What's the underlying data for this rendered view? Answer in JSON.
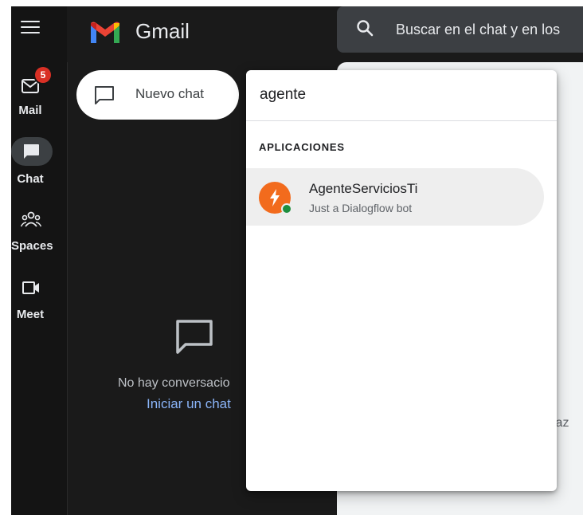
{
  "app": {
    "name": "Gmail"
  },
  "rail": {
    "mail": {
      "label": "Mail",
      "badge": "5"
    },
    "chat": {
      "label": "Chat"
    },
    "spaces": {
      "label": "Spaces"
    },
    "meet": {
      "label": "Meet"
    }
  },
  "search": {
    "placeholder": "Buscar en el chat y en los"
  },
  "new_chat": {
    "label": "Nuevo chat"
  },
  "empty_state": {
    "text": "No hay conversacio",
    "link": "Iniciar un chat"
  },
  "main_hint": "Haz",
  "dropdown": {
    "query": "agente",
    "section": "APLICACIONES",
    "results": [
      {
        "name": "AgenteServiciosTi",
        "subtitle": "Just a Dialogflow bot"
      }
    ]
  },
  "colors": {
    "background": "#1a1a1a",
    "rail": "#141414",
    "badge": "#d93025",
    "link": "#8ab4f8",
    "avatar": "#f26b1d",
    "presence": "#1e8e3e"
  }
}
